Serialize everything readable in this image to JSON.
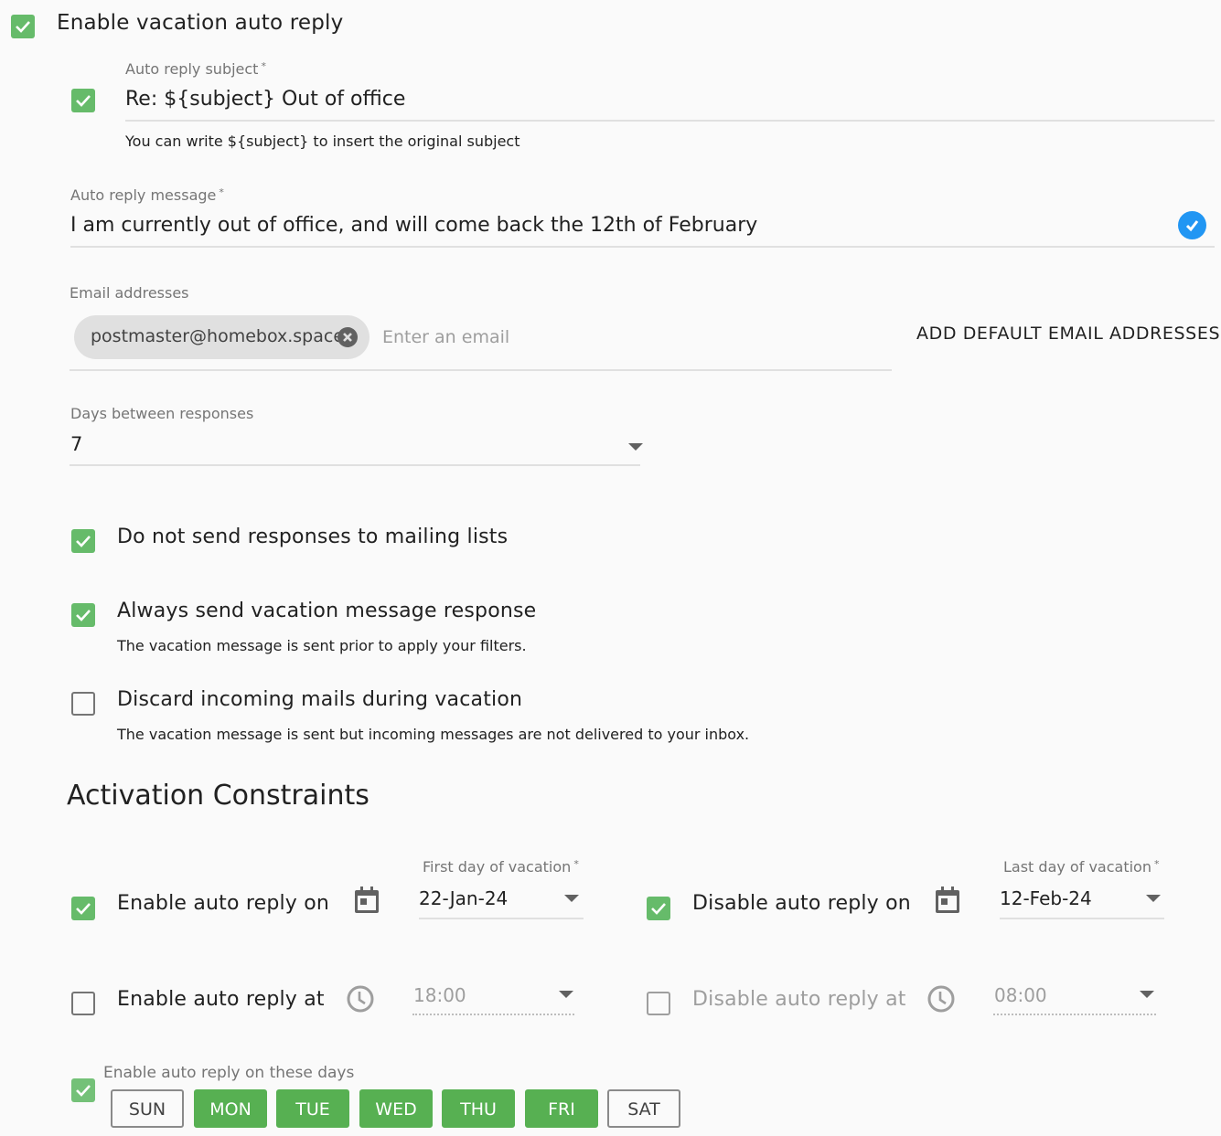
{
  "vacation": {
    "enable_label": "Enable vacation auto reply",
    "enable_checked": true,
    "subject": {
      "label": "Auto reply subject",
      "required_mark": "*",
      "checked": true,
      "value": "Re: ${subject} Out of office",
      "hint": "You can write ${subject} to insert the original subject"
    },
    "message": {
      "label": "Auto reply message",
      "required_mark": "*",
      "value": "I am currently out of office, and will come back the 12th of February",
      "status_icon": "check-circle-icon",
      "status_color": "#2196f3"
    },
    "emails": {
      "label": "Email addresses",
      "chips": [
        "postmaster@homebox.space"
      ],
      "input_placeholder": "Enter an email",
      "add_default_label": "ADD DEFAULT EMAIL ADDRESSES"
    },
    "days_between": {
      "label": "Days between responses",
      "value": "7"
    },
    "options": [
      {
        "label": "Do not send responses to mailing lists",
        "checked": true,
        "hint": ""
      },
      {
        "label": "Always send vacation message response",
        "checked": true,
        "hint": "The vacation message is sent prior to apply your filters."
      },
      {
        "label": "Discard incoming mails during vacation",
        "checked": false,
        "hint": "The vacation message is sent but incoming messages are not delivered to your inbox."
      }
    ]
  },
  "constraints": {
    "title": "Activation Constraints",
    "enable_on": {
      "label": "Enable auto reply on",
      "checked": true,
      "field_label": "First day of vacation",
      "required_mark": "*",
      "value": "22-Jan-24",
      "icon": "calendar-icon"
    },
    "disable_on": {
      "label": "Disable auto reply on",
      "checked": true,
      "field_label": "Last day of vacation",
      "required_mark": "*",
      "value": "12-Feb-24",
      "icon": "calendar-icon"
    },
    "enable_at": {
      "label": "Enable auto reply at",
      "checked": false,
      "value": "18:00",
      "icon": "clock-icon"
    },
    "disable_at": {
      "label": "Disable auto reply at",
      "checked": false,
      "value": "08:00",
      "icon": "clock-icon"
    },
    "days": {
      "label": "Enable auto reply on these days",
      "checked": true,
      "items": [
        {
          "label": "SUN",
          "selected": false
        },
        {
          "label": "MON",
          "selected": true
        },
        {
          "label": "TUE",
          "selected": true
        },
        {
          "label": "WED",
          "selected": true
        },
        {
          "label": "THU",
          "selected": true
        },
        {
          "label": "FRI",
          "selected": true
        },
        {
          "label": "SAT",
          "selected": false
        }
      ]
    }
  },
  "colors": {
    "checkbox_checked": "#66bb6a",
    "day_selected": "#57b052",
    "accent_blue": "#2196f3"
  }
}
